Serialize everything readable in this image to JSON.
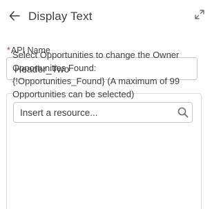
{
  "header": {
    "back_icon": "arrow-left-icon",
    "title": "Display Text",
    "expand_icon": "expand-icon"
  },
  "api_name": {
    "required_marker": "*",
    "label": "API Name",
    "value": "Header_Two"
  },
  "resource_search": {
    "placeholder": "Insert a resource...",
    "icon": "search-icon"
  },
  "editor": {
    "lines": [
      "Select Opportunities to change the Owner",
      "Opportunities Found:",
      "{!Opportunities_Found} (A maximum of 99",
      "Opportunities can be selected)"
    ]
  }
}
